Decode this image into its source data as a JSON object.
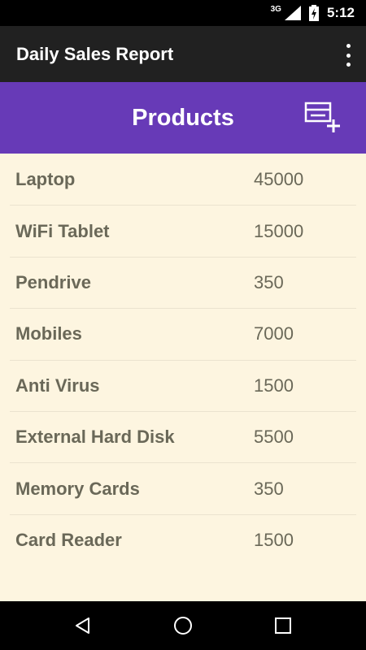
{
  "status_bar": {
    "network": "3G",
    "time": "5:12"
  },
  "app_bar": {
    "title": "Daily Sales Report",
    "menu_icon": "more-vert-icon"
  },
  "header": {
    "title": "Products",
    "action_icon": "add-to-list-icon"
  },
  "products": [
    {
      "name": "Laptop",
      "price": "45000"
    },
    {
      "name": "WiFi Tablet",
      "price": "15000"
    },
    {
      "name": "Pendrive",
      "price": "350"
    },
    {
      "name": "Mobiles",
      "price": "7000"
    },
    {
      "name": "Anti Virus",
      "price": "1500"
    },
    {
      "name": "External Hard Disk",
      "price": "5500"
    },
    {
      "name": "Memory Cards",
      "price": "350"
    },
    {
      "name": "Card Reader",
      "price": "1500"
    }
  ],
  "colors": {
    "header_bg": "#673ab7",
    "app_bar_bg": "#212121",
    "list_bg": "#fdf5e0",
    "text": "#6a6858"
  },
  "nav_bar": {
    "icons": [
      "back-icon",
      "home-icon",
      "recents-icon"
    ]
  }
}
